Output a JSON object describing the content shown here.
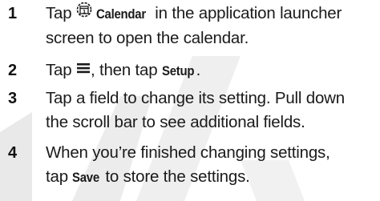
{
  "steps": [
    {
      "number": "1",
      "line1_before": "Tap ",
      "line1_icon": "calendar-icon",
      "line1_keyword": "Calendar",
      "line1_after": " in the application launcher",
      "line2": "screen to open the calendar."
    },
    {
      "number": "2",
      "before": "Tap ",
      "icon": "menu-icon",
      "middle": ", then tap ",
      "keyword": "Setup",
      "after": "."
    },
    {
      "number": "3",
      "line1": "Tap a field to change its setting. Pull down",
      "line2": "the scroll bar to see additional fields."
    },
    {
      "number": "4",
      "line1": "When you’re finished changing settings,",
      "line2_before": "tap ",
      "line2_keyword": "Save",
      "line2_after": " to store the settings."
    }
  ]
}
